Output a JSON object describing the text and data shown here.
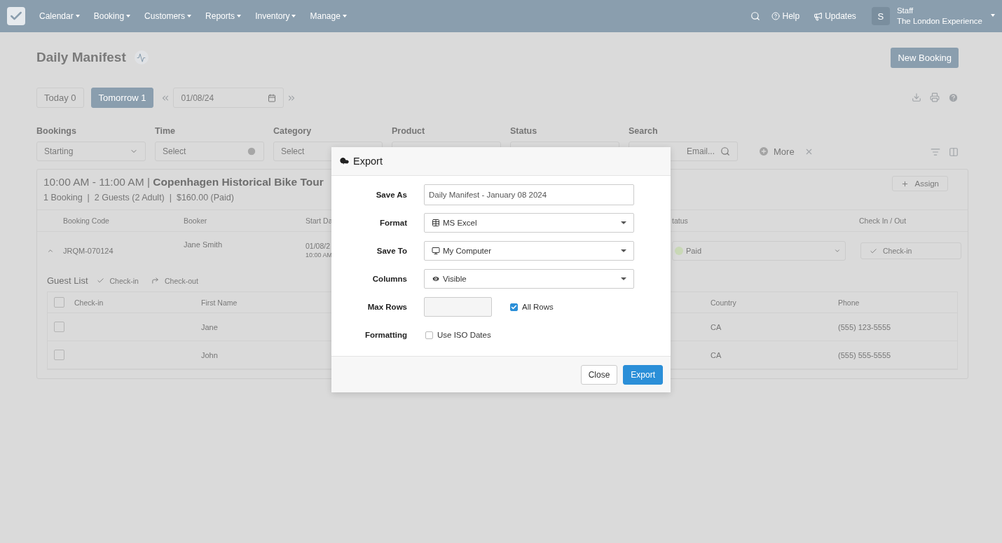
{
  "nav": {
    "items": [
      "Calendar",
      "Booking",
      "Customers",
      "Reports",
      "Inventory",
      "Manage"
    ],
    "help": "Help",
    "updates": "Updates",
    "user": {
      "initial": "S",
      "name": "Staff",
      "company": "The London Experience"
    }
  },
  "page": {
    "title": "Daily Manifest",
    "new_booking": "New Booking"
  },
  "day_tabs": [
    {
      "label": "Today 0",
      "selected": false
    },
    {
      "label": "Tomorrow 1",
      "selected": true
    }
  ],
  "date": "01/08/24",
  "filters": [
    {
      "kind": "select",
      "label": "Bookings",
      "value": "Starting"
    },
    {
      "kind": "time",
      "label": "Time",
      "placeholder": "Select"
    },
    {
      "kind": "select",
      "label": "Category",
      "placeholder": "Select"
    },
    {
      "kind": "select",
      "label": "Product"
    },
    {
      "kind": "select",
      "label": "Status"
    },
    {
      "kind": "search",
      "label": "Search",
      "placeholder": "Email..."
    }
  ],
  "more": "More",
  "session": {
    "heading": "10:00 AM - 11:00 AM | **Copenhagen Historical Bike Tour**",
    "summary": "1 Booking  |  2 Guests (2 Adult)  |  $160.00 (Paid)",
    "assign": "Assign"
  },
  "booking_table": {
    "columns": [
      "Booking Code",
      "Booker",
      "Start Da",
      "tatus",
      "Check In / Out"
    ],
    "row": {
      "expanded": true,
      "code": "JRQM-070124",
      "booker": "Jane Smith",
      "start_date": "01/08/2",
      "start_time": "10:00 AM",
      "status": "Paid",
      "color": "#c9d8b6",
      "check_in": "Check-in"
    }
  },
  "guest_list": {
    "title": "Guest List",
    "all_checked": false,
    "actions": [
      "Check-in",
      "Check-out"
    ],
    "columns": [
      "Check-in",
      "First Name",
      "Country",
      "Phone"
    ],
    "rows": [
      {
        "checked": false,
        "first_name": "Jane",
        "country": "CA",
        "phone": "(555) 123-5555"
      },
      {
        "checked": false,
        "first_name": "John",
        "country": "CA",
        "phone": "(555) 555-5555"
      }
    ]
  },
  "export_dialog": {
    "title": "Export",
    "save_as_label": "Save As",
    "save_as": "Daily Manifest - January 08 2024",
    "format_label": "Format",
    "format": "MS Excel",
    "save_to_label": "Save To",
    "save_to": "My Computer",
    "columns_label": "Columns",
    "columns": "Visible",
    "max_rows_label": "Max Rows",
    "all_rows": {
      "label": "All Rows",
      "checked": true
    },
    "formatting_label": "Formatting",
    "iso_dates": {
      "label": "Use ISO Dates",
      "checked": false
    },
    "buttons": [
      "Close",
      "Export"
    ]
  }
}
